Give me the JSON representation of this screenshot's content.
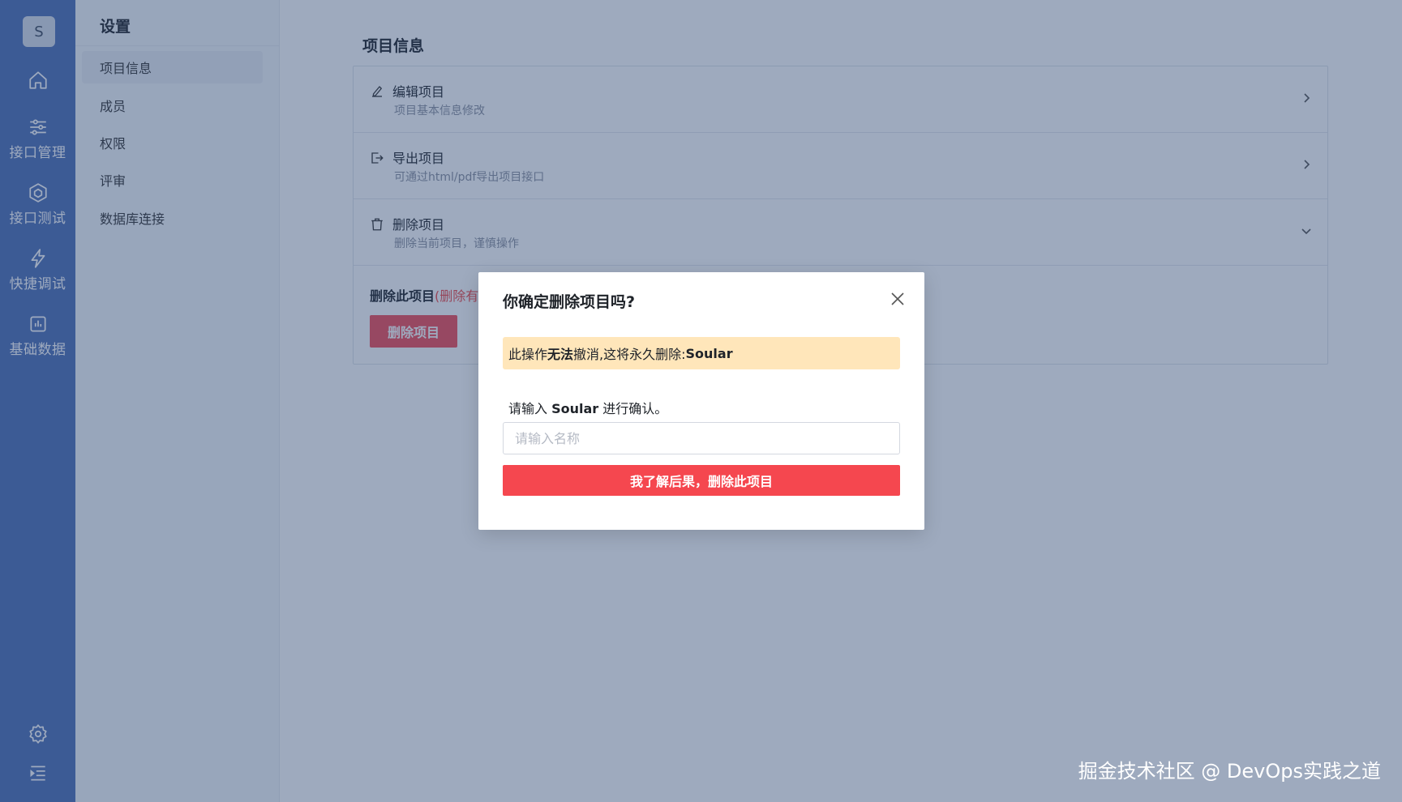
{
  "rail": {
    "avatar": "S",
    "items": [
      {
        "icon": "home-icon",
        "label": ""
      },
      {
        "icon": "sliders-icon",
        "label": "接口管理"
      },
      {
        "icon": "hexagon-icon",
        "label": "接口测试"
      },
      {
        "icon": "lightning-icon",
        "label": "快捷调试"
      },
      {
        "icon": "chart-icon",
        "label": "基础数据"
      }
    ],
    "bottom": [
      {
        "icon": "gear-icon"
      },
      {
        "icon": "menu-fold-icon"
      }
    ]
  },
  "sidebar": {
    "title": "设置",
    "items": [
      {
        "label": "项目信息",
        "active": true
      },
      {
        "label": "成员"
      },
      {
        "label": "权限"
      },
      {
        "label": "评审"
      },
      {
        "label": "数据库连接"
      }
    ]
  },
  "main": {
    "section_title": "项目信息",
    "rows": [
      {
        "icon": "edit-icon",
        "title": "编辑项目",
        "subtitle": "项目基本信息修改",
        "chevron": "chevron-right-icon"
      },
      {
        "icon": "export-icon",
        "title": "导出项目",
        "subtitle": "可通过html/pdf导出项目接口",
        "chevron": "chevron-right-icon"
      },
      {
        "icon": "trash-icon",
        "title": "删除项目",
        "subtitle": "删除当前项目，谨慎操作",
        "chevron": "chevron-down-icon"
      }
    ],
    "danger_label": "删除此项目",
    "danger_label_red": "(删除有",
    "danger_button": "删除项目"
  },
  "modal": {
    "title": "你确定删除项目吗?",
    "warning_prefix": "此操作",
    "warning_bold": "无法",
    "warning_middle": "撤消,这将永久删除:",
    "warning_name": "Soular",
    "confirm_prefix": "请输入",
    "confirm_name": "Soular",
    "confirm_suffix": "进行确认。",
    "input_placeholder": "请输入名称",
    "input_value": "",
    "confirm_button": "我了解后果，删除此项目"
  },
  "watermark": "掘金技术社区 @ DevOps实践之道",
  "colors": {
    "rail": "#4e6fb4",
    "danger": "#f5474f",
    "warning_bg": "#ffe6ba"
  }
}
